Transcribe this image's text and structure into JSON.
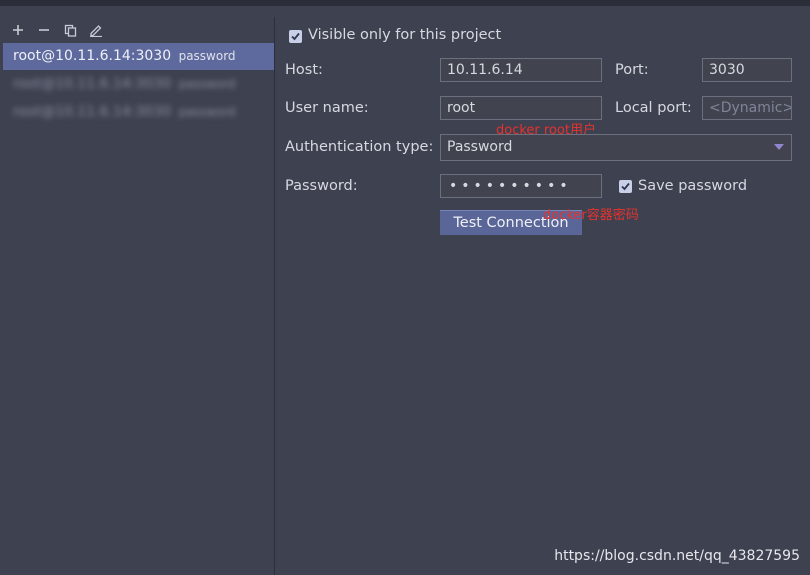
{
  "toolbar": {
    "add_icon": "plus-icon",
    "remove_icon": "minus-icon",
    "copy_icon": "copy-icon",
    "edit_icon": "pencil-icon"
  },
  "connections": [
    {
      "host": "root@10.11.6.14:3030",
      "auth": "password",
      "selected": true
    },
    {
      "host": "root@10.11.6.14:3030",
      "auth": "password",
      "selected": false,
      "blurred": true
    },
    {
      "host": "root@10.11.6.14:3030",
      "auth": "password",
      "selected": false,
      "blurred": true
    }
  ],
  "form": {
    "visible_only_label": "Visible only for this project",
    "visible_only_checked": true,
    "host_label": "Host:",
    "host_value": "10.11.6.14",
    "port_label": "Port:",
    "port_value": "3030",
    "username_label": "User name:",
    "username_value": "root",
    "local_port_label": "Local port:",
    "local_port_placeholder": "<Dynamic>",
    "auth_type_label": "Authentication type:",
    "auth_type_value": "Password",
    "password_label": "Password:",
    "password_mask": "••••••••••",
    "save_password_label": "Save password",
    "save_password_checked": true,
    "test_connection_label": "Test Connection"
  },
  "annotations": {
    "user_note": "docker root用户",
    "password_note": "docker容器密码"
  },
  "watermark": "https://blog.csdn.net/qq_43827595",
  "colors": {
    "background": "#3e4150",
    "selection": "#5e6a9d",
    "button": "#5a6698",
    "annotation": "#e8322c"
  }
}
